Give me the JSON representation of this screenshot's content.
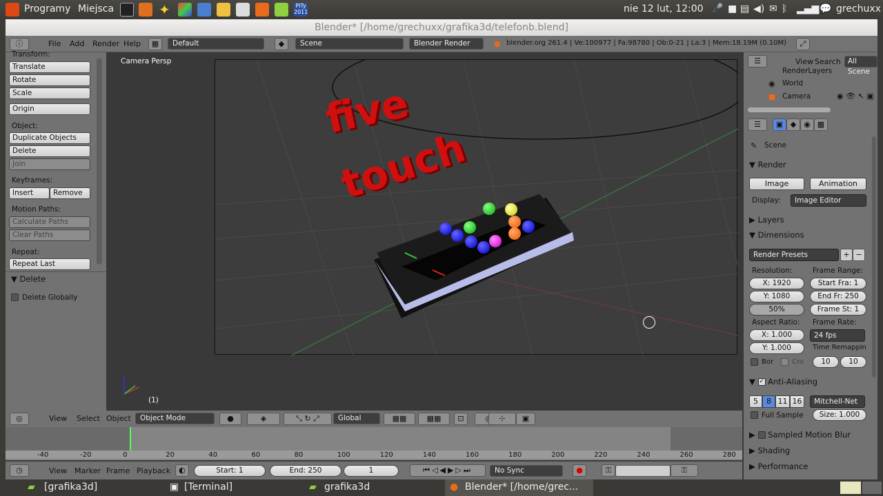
{
  "system_bar": {
    "menu_programs": "Programy",
    "menu_places": "Miejsca",
    "datetime": "nie 12 lut, 12:00",
    "user": "grechuxx",
    "pity_badge": "PITy 2011"
  },
  "window_title": "Blender* [/home/grechuxx/grafika3d/telefonb.blend]",
  "info_header": {
    "menus": [
      "File",
      "Add",
      "Render",
      "Help"
    ],
    "layout": "Default",
    "scene": "Scene",
    "engine": "Blender Render",
    "stats": "blender.org 261.4 | Ve:100977 | Fa:98780 | Ob:0-21 | La:3 | Mem:18.19M (0.10M)"
  },
  "toolshelf": {
    "transform_label": "Transform:",
    "translate": "Translate",
    "rotate": "Rotate",
    "scale": "Scale",
    "origin": "Origin",
    "object_label": "Object:",
    "duplicate": "Duplicate Objects",
    "delete": "Delete",
    "join": "Join",
    "keyframes_label": "Keyframes:",
    "insert": "Insert",
    "remove": "Remove",
    "motion_paths_label": "Motion Paths:",
    "calculate_paths": "Calculate Paths",
    "clear_paths": "Clear Paths",
    "repeat_label": "Repeat:",
    "repeat_last": "Repeat Last",
    "delete_panel": "Delete",
    "delete_globally": "Delete Globally"
  },
  "viewport": {
    "view_name": "Camera Persp",
    "frame_indicator": "(1)",
    "text_line1": "five",
    "text_line2": "touch"
  },
  "view3d_header": {
    "menus": [
      "View",
      "Select",
      "Object"
    ],
    "mode": "Object Mode",
    "orientation": "Global"
  },
  "timeline": {
    "ticks": [
      "-40",
      "-20",
      "0",
      "20",
      "40",
      "60",
      "80",
      "100",
      "120",
      "140",
      "160",
      "180",
      "200",
      "220",
      "240",
      "260",
      "280"
    ],
    "current_frame": 1
  },
  "timeline_header": {
    "menus": [
      "View",
      "Marker",
      "Frame",
      "Playback"
    ],
    "start": "Start: 1",
    "end": "End: 250",
    "frame": "1",
    "sync": "No Sync"
  },
  "outliner": {
    "menus": [
      "View",
      "Search"
    ],
    "filter": "All Scene",
    "items": [
      "RenderLayers",
      "World",
      "Camera"
    ]
  },
  "properties": {
    "context": "Scene",
    "render_panel": "Render",
    "image_button": "Image",
    "animation_button": "Animation",
    "display_label": "Display:",
    "display_value": "Image Editor",
    "layers_panel": "Layers",
    "dimensions_panel": "Dimensions",
    "render_presets": "Render Presets",
    "resolution_label": "Resolution:",
    "res_x": "X: 1920",
    "res_y": "Y: 1080",
    "res_pct": "50%",
    "frame_range_label": "Frame Range:",
    "start_frame": "Start Fra: 1",
    "end_frame": "End Fr: 250",
    "frame_step": "Frame St: 1",
    "aspect_label": "Aspect Ratio:",
    "aspect_x": "X: 1.000",
    "aspect_y": "Y: 1.000",
    "frame_rate_label": "Frame Rate:",
    "frame_rate": "24 fps",
    "time_remap_label": "Time Remappin",
    "remap_old": "10",
    "remap_new": "10",
    "border": "Bor",
    "crop": "Cro",
    "aa_panel": "Anti-Aliasing",
    "aa_samples": [
      "5",
      "8",
      "11",
      "16"
    ],
    "aa_filter": "Mitchell-Net",
    "full_sample": "Full Sample",
    "aa_size": "Size: 1.000",
    "motion_blur_panel": "Sampled Motion Blur",
    "shading_panel": "Shading",
    "performance_panel": "Performance"
  },
  "taskbar": {
    "items": [
      "[grafika3d]",
      "[Terminal]",
      "grafika3d",
      "Blender* [/home/grec..."
    ]
  }
}
